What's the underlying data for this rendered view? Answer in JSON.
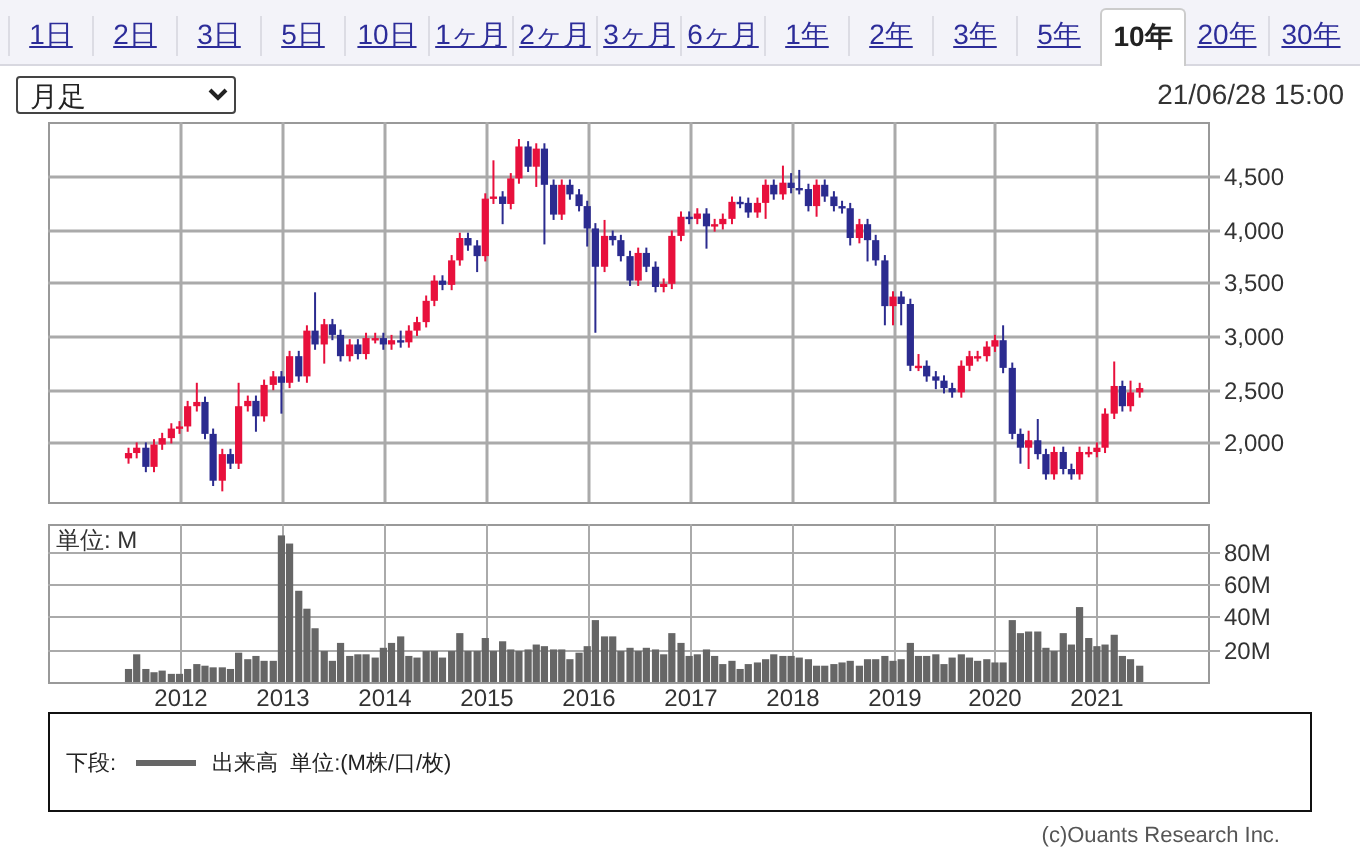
{
  "tabs": [
    {
      "label": "1日",
      "selected": false
    },
    {
      "label": "2日",
      "selected": false
    },
    {
      "label": "3日",
      "selected": false
    },
    {
      "label": "5日",
      "selected": false
    },
    {
      "label": "10日",
      "selected": false
    },
    {
      "label": "1ヶ月",
      "selected": false
    },
    {
      "label": "2ヶ月",
      "selected": false
    },
    {
      "label": "3ヶ月",
      "selected": false
    },
    {
      "label": "6ヶ月",
      "selected": false
    },
    {
      "label": "1年",
      "selected": false
    },
    {
      "label": "2年",
      "selected": false
    },
    {
      "label": "3年",
      "selected": false
    },
    {
      "label": "5年",
      "selected": false
    },
    {
      "label": "10年",
      "selected": true
    },
    {
      "label": "20年",
      "selected": false
    },
    {
      "label": "30年",
      "selected": false
    }
  ],
  "toolbar": {
    "interval_select": "月足",
    "timestamp": "21/06/28 15:00"
  },
  "price_chart": {
    "chart_data": {
      "type": "candlestick",
      "grid": true,
      "xlim": [
        2010.71,
        2022.09
      ],
      "ylim": [
        1440,
        5010
      ],
      "yticks": [
        {
          "value": 2000,
          "label": "2,000"
        },
        {
          "value": 2500,
          "label": "2,500"
        },
        {
          "value": 3000,
          "label": "3,000"
        },
        {
          "value": 3500,
          "label": "3,500"
        },
        {
          "value": 4000,
          "label": "4,000"
        },
        {
          "value": 4500,
          "label": "4,500"
        }
      ],
      "x": [
        2011.5,
        2011.58,
        2011.67,
        2011.75,
        2011.83,
        2011.92,
        2012,
        2012.08,
        2012.17,
        2012.25,
        2012.33,
        2012.42,
        2012.5,
        2012.58,
        2012.67,
        2012.75,
        2012.83,
        2012.92,
        2013,
        2013.08,
        2013.17,
        2013.25,
        2013.33,
        2013.42,
        2013.5,
        2013.58,
        2013.67,
        2013.75,
        2013.83,
        2013.92,
        2014,
        2014.08,
        2014.17,
        2014.25,
        2014.33,
        2014.42,
        2014.5,
        2014.58,
        2014.67,
        2014.75,
        2014.83,
        2014.92,
        2015,
        2015.08,
        2015.17,
        2015.25,
        2015.33,
        2015.42,
        2015.5,
        2015.58,
        2015.67,
        2015.75,
        2015.83,
        2015.92,
        2016,
        2016.08,
        2016.17,
        2016.25,
        2016.33,
        2016.42,
        2016.5,
        2016.58,
        2016.67,
        2016.75,
        2016.83,
        2016.92,
        2017,
        2017.08,
        2017.17,
        2017.25,
        2017.33,
        2017.42,
        2017.5,
        2017.58,
        2017.67,
        2017.75,
        2017.83,
        2017.92,
        2018,
        2018.08,
        2018.17,
        2018.25,
        2018.33,
        2018.42,
        2018.5,
        2018.58,
        2018.67,
        2018.75,
        2018.83,
        2018.92,
        2019,
        2019.08,
        2019.17,
        2019.25,
        2019.33,
        2019.42,
        2019.5,
        2019.58,
        2019.67,
        2019.75,
        2019.83,
        2019.92,
        2020,
        2020.08,
        2020.17,
        2020.25,
        2020.33,
        2020.42,
        2020.5,
        2020.58,
        2020.67,
        2020.75,
        2020.83,
        2020.92,
        2021,
        2021.08,
        2021.17,
        2021.25,
        2021.33,
        2021.42
      ],
      "ohlc": [
        [
          1850,
          1950,
          1800,
          1900
        ],
        [
          1900,
          2000,
          1850,
          1950
        ],
        [
          1950,
          2000,
          1720,
          1770
        ],
        [
          1770,
          2030,
          1720,
          1980
        ],
        [
          1980,
          2090,
          1930,
          2040
        ],
        [
          2040,
          2180,
          1990,
          2130
        ],
        [
          2130,
          2200,
          2080,
          2150
        ],
        [
          2150,
          2390,
          2100,
          2340
        ],
        [
          2340,
          2560,
          2290,
          2380
        ],
        [
          2380,
          2430,
          2030,
          2080
        ],
        [
          2080,
          2130,
          1590,
          1640
        ],
        [
          1640,
          1940,
          1540,
          1890
        ],
        [
          1890,
          1940,
          1750,
          1800
        ],
        [
          1800,
          2560,
          1750,
          2340
        ],
        [
          2340,
          2440,
          2290,
          2390
        ],
        [
          2390,
          2440,
          2100,
          2245
        ],
        [
          2245,
          2590,
          2195,
          2540
        ],
        [
          2540,
          2670,
          2490,
          2620
        ],
        [
          2620,
          2670,
          2270,
          2560
        ],
        [
          2560,
          2860,
          2510,
          2810
        ],
        [
          2810,
          2860,
          2570,
          2620
        ],
        [
          2620,
          3100,
          2560,
          3050
        ],
        [
          3050,
          3410,
          2870,
          2920
        ],
        [
          2920,
          3160,
          2740,
          3110
        ],
        [
          3110,
          3160,
          2960,
          3010
        ],
        [
          3010,
          3060,
          2760,
          2810
        ],
        [
          2810,
          2970,
          2760,
          2920
        ],
        [
          2920,
          2970,
          2780,
          2830
        ],
        [
          2830,
          3030,
          2780,
          2980
        ],
        [
          2980,
          3030,
          2930,
          2980
        ],
        [
          2980,
          3030,
          2870,
          2920
        ],
        [
          2920,
          3010,
          2870,
          2960
        ],
        [
          2960,
          3050,
          2890,
          2940
        ],
        [
          2940,
          3100,
          2890,
          3050
        ],
        [
          3050,
          3180,
          3000,
          3130
        ],
        [
          3130,
          3380,
          3080,
          3330
        ],
        [
          3330,
          3570,
          3280,
          3520
        ],
        [
          3520,
          3570,
          3430,
          3480
        ],
        [
          3480,
          3760,
          3430,
          3710
        ],
        [
          3710,
          3970,
          3660,
          3920
        ],
        [
          3920,
          3970,
          3800,
          3850
        ],
        [
          3850,
          3900,
          3600,
          3750
        ],
        [
          3750,
          4340,
          3700,
          4290
        ],
        [
          4290,
          4650,
          4240,
          4310
        ],
        [
          4310,
          4360,
          4050,
          4240
        ],
        [
          4240,
          4530,
          4190,
          4480
        ],
        [
          4480,
          4850,
          4430,
          4780
        ],
        [
          4780,
          4830,
          4540,
          4590
        ],
        [
          4590,
          4810,
          4400,
          4760
        ],
        [
          4760,
          4810,
          3860,
          4420
        ],
        [
          4420,
          4470,
          4090,
          4140
        ],
        [
          4140,
          4470,
          4090,
          4420
        ],
        [
          4420,
          4470,
          4280,
          4330
        ],
        [
          4330,
          4380,
          4170,
          4220
        ],
        [
          4220,
          4270,
          3840,
          4010
        ],
        [
          4010,
          4060,
          3030,
          3650
        ],
        [
          3650,
          4090,
          3600,
          3940
        ],
        [
          3940,
          3990,
          3850,
          3900
        ],
        [
          3900,
          3950,
          3700,
          3750
        ],
        [
          3750,
          3800,
          3470,
          3520
        ],
        [
          3520,
          3830,
          3470,
          3780
        ],
        [
          3780,
          3830,
          3600,
          3650
        ],
        [
          3650,
          3700,
          3410,
          3460
        ],
        [
          3460,
          3540,
          3410,
          3490
        ],
        [
          3490,
          3990,
          3440,
          3940
        ],
        [
          3940,
          4170,
          3890,
          4120
        ],
        [
          4120,
          4170,
          4050,
          4100
        ],
        [
          4100,
          4200,
          4050,
          4150
        ],
        [
          4150,
          4200,
          3820,
          4030
        ],
        [
          4030,
          4100,
          3980,
          4050
        ],
        [
          4050,
          4150,
          4000,
          4100
        ],
        [
          4100,
          4310,
          4050,
          4260
        ],
        [
          4260,
          4310,
          4200,
          4250
        ],
        [
          4250,
          4300,
          4110,
          4160
        ],
        [
          4160,
          4300,
          4110,
          4250
        ],
        [
          4250,
          4470,
          4100,
          4420
        ],
        [
          4420,
          4470,
          4280,
          4330
        ],
        [
          4330,
          4600,
          4280,
          4440
        ],
        [
          4440,
          4530,
          4340,
          4390
        ],
        [
          4390,
          4560,
          4330,
          4380
        ],
        [
          4380,
          4430,
          4170,
          4220
        ],
        [
          4220,
          4470,
          4120,
          4420
        ],
        [
          4420,
          4470,
          4260,
          4310
        ],
        [
          4310,
          4360,
          4170,
          4220
        ],
        [
          4220,
          4270,
          4150,
          4200
        ],
        [
          4200,
          4250,
          3850,
          3920
        ],
        [
          3920,
          4100,
          3870,
          4050
        ],
        [
          4050,
          4100,
          3700,
          3900
        ],
        [
          3900,
          3950,
          3660,
          3710
        ],
        [
          3710,
          3760,
          3100,
          3280
        ],
        [
          3280,
          3420,
          3100,
          3370
        ],
        [
          3370,
          3420,
          3100,
          3300
        ],
        [
          3300,
          3350,
          2670,
          2720
        ],
        [
          2720,
          2830,
          2670,
          2720
        ],
        [
          2720,
          2770,
          2570,
          2620
        ],
        [
          2620,
          2670,
          2500,
          2580
        ],
        [
          2580,
          2630,
          2460,
          2510
        ],
        [
          2510,
          2560,
          2420,
          2470
        ],
        [
          2470,
          2770,
          2420,
          2720
        ],
        [
          2720,
          2860,
          2670,
          2810
        ],
        [
          2810,
          2860,
          2760,
          2810
        ],
        [
          2810,
          2950,
          2760,
          2900
        ],
        [
          2900,
          3010,
          2850,
          2960
        ],
        [
          2960,
          3100,
          2650,
          2700
        ],
        [
          2700,
          2750,
          2030,
          2080
        ],
        [
          2080,
          2130,
          1800,
          1950
        ],
        [
          1950,
          2110,
          1750,
          2020
        ],
        [
          2020,
          2220,
          1840,
          1890
        ],
        [
          1890,
          1940,
          1650,
          1700
        ],
        [
          1700,
          1960,
          1650,
          1910
        ],
        [
          1910,
          1960,
          1700,
          1750
        ],
        [
          1750,
          1800,
          1650,
          1700
        ],
        [
          1700,
          1960,
          1650,
          1910
        ],
        [
          1910,
          1960,
          1860,
          1910
        ],
        [
          1910,
          2000,
          1860,
          1950
        ],
        [
          1950,
          2320,
          1900,
          2270
        ],
        [
          2270,
          2760,
          2220,
          2530
        ],
        [
          2530,
          2580,
          2290,
          2340
        ],
        [
          2340,
          2580,
          2290,
          2470
        ],
        [
          2470,
          2560,
          2420,
          2510
        ]
      ]
    }
  },
  "volume_chart": {
    "unit_label": "単位: M",
    "chart_data": {
      "type": "bar",
      "grid": true,
      "xlim": [
        2010.71,
        2022.09
      ],
      "ylim": [
        0,
        97
      ],
      "xticks": [
        2012,
        2013,
        2014,
        2015,
        2016,
        2017,
        2018,
        2019,
        2020,
        2021
      ],
      "yticks": [
        {
          "value": 20,
          "label": "20M"
        },
        {
          "value": 40,
          "label": "40M"
        },
        {
          "value": 60,
          "label": "60M"
        },
        {
          "value": 80,
          "label": "80M"
        }
      ],
      "x": [
        2011.5,
        2011.58,
        2011.67,
        2011.75,
        2011.83,
        2011.92,
        2012,
        2012.08,
        2012.17,
        2012.25,
        2012.33,
        2012.42,
        2012.5,
        2012.58,
        2012.67,
        2012.75,
        2012.83,
        2012.92,
        2013,
        2013.08,
        2013.17,
        2013.25,
        2013.33,
        2013.42,
        2013.5,
        2013.58,
        2013.67,
        2013.75,
        2013.83,
        2013.92,
        2014,
        2014.08,
        2014.17,
        2014.25,
        2014.33,
        2014.42,
        2014.5,
        2014.58,
        2014.67,
        2014.75,
        2014.83,
        2014.92,
        2015,
        2015.08,
        2015.17,
        2015.25,
        2015.33,
        2015.42,
        2015.5,
        2015.58,
        2015.67,
        2015.75,
        2015.83,
        2015.92,
        2016,
        2016.08,
        2016.17,
        2016.25,
        2016.33,
        2016.42,
        2016.5,
        2016.58,
        2016.67,
        2016.75,
        2016.83,
        2016.92,
        2017,
        2017.08,
        2017.17,
        2017.25,
        2017.33,
        2017.42,
        2017.5,
        2017.58,
        2017.67,
        2017.75,
        2017.83,
        2017.92,
        2018,
        2018.08,
        2018.17,
        2018.25,
        2018.33,
        2018.42,
        2018.5,
        2018.58,
        2018.67,
        2018.75,
        2018.83,
        2018.92,
        2019,
        2019.08,
        2019.17,
        2019.25,
        2019.33,
        2019.42,
        2019.5,
        2019.58,
        2019.67,
        2019.75,
        2019.83,
        2019.92,
        2020,
        2020.08,
        2020.17,
        2020.25,
        2020.33,
        2020.42,
        2020.5,
        2020.58,
        2020.67,
        2020.75,
        2020.83,
        2020.92,
        2021,
        2021.08,
        2021.17,
        2021.25,
        2021.33,
        2021.42
      ],
      "series": [
        {
          "name": "出来高",
          "color": "#666666",
          "values": [
            8,
            17,
            8,
            6,
            7,
            5,
            5,
            8,
            11,
            10,
            9,
            9,
            8,
            18,
            14,
            16,
            13,
            13,
            90,
            85,
            56,
            45,
            33,
            19,
            13,
            24,
            16,
            17,
            17,
            15,
            21,
            24,
            28,
            16,
            15,
            19,
            19,
            15,
            19,
            30,
            19,
            19,
            27,
            19,
            25,
            20,
            19,
            20,
            23,
            22,
            20,
            20,
            14,
            18,
            22,
            38,
            28,
            28,
            19,
            21,
            19,
            21,
            20,
            17,
            30,
            24,
            16,
            17,
            20,
            16,
            11,
            13,
            8,
            11,
            12,
            14,
            17,
            16,
            16,
            15,
            14,
            10,
            10,
            11,
            12,
            13,
            10,
            14,
            14,
            16,
            13,
            14,
            24,
            16,
            16,
            17,
            11,
            15,
            17,
            15,
            13,
            14,
            12,
            12,
            38,
            30,
            31,
            31,
            21,
            19,
            30,
            23,
            46,
            27,
            22,
            23,
            29,
            16,
            14,
            10
          ]
        }
      ]
    }
  },
  "legend": {
    "prefix": "下段:",
    "unit": "単位:(M株/口/枚)"
  },
  "copyright": "(c)Ouants Research Inc."
}
